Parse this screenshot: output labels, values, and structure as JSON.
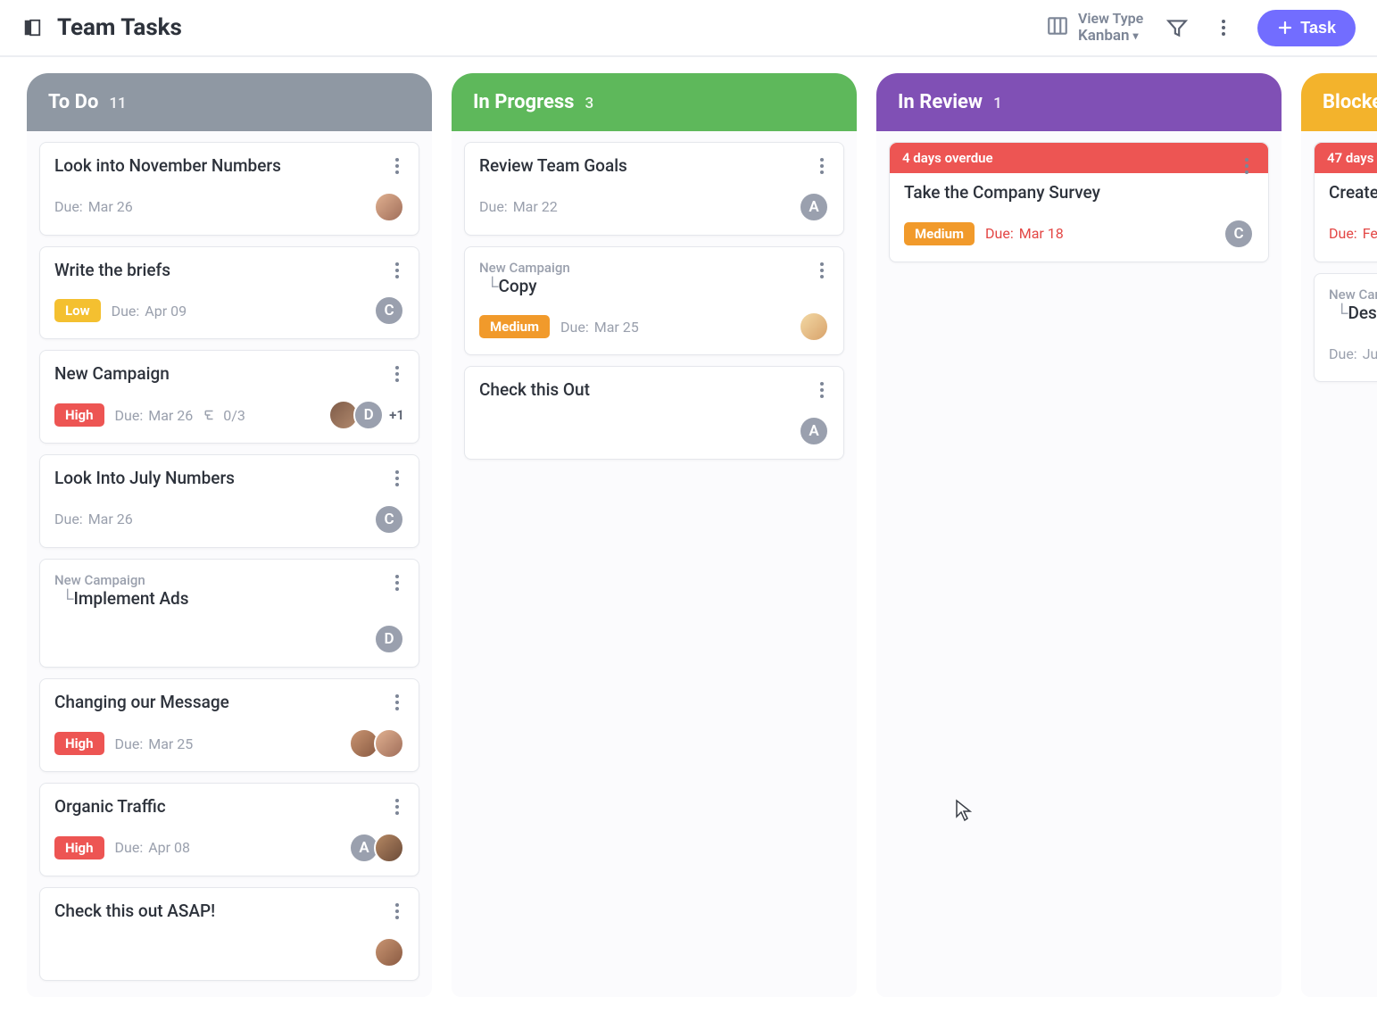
{
  "header": {
    "title": "Team Tasks",
    "view_type_label": "View Type",
    "view_type_value": "Kanban",
    "add_task_label": "Task"
  },
  "columns": [
    {
      "id": "todo",
      "title": "To Do",
      "count": "11",
      "cards": [
        {
          "title": "Look into November Numbers",
          "due": "Mar 26",
          "assignees": [
            {
              "t": "p",
              "v": "p1"
            }
          ]
        },
        {
          "title": "Write the briefs",
          "priority": "Low",
          "due": "Apr 09",
          "assignees": [
            {
              "t": "l",
              "v": "C"
            }
          ]
        },
        {
          "title": "New Campaign",
          "priority": "High",
          "due": "Mar 26",
          "subtasks": "0/3",
          "assignees": [
            {
              "t": "p",
              "v": "p3"
            },
            {
              "t": "l",
              "v": "D"
            }
          ],
          "more_count": "+1"
        },
        {
          "title": "Look Into July Numbers",
          "due": "Mar 26",
          "assignees": [
            {
              "t": "l",
              "v": "C"
            }
          ]
        },
        {
          "parent": "New Campaign",
          "title": "Implement Ads",
          "assignees": [
            {
              "t": "l",
              "v": "D"
            }
          ]
        },
        {
          "title": "Changing our Message",
          "priority": "High",
          "due": "Mar 25",
          "assignees": [
            {
              "t": "p",
              "v": "p4"
            },
            {
              "t": "p",
              "v": "p1"
            }
          ]
        },
        {
          "title": "Organic Traffic",
          "priority": "High",
          "due": "Apr 08",
          "assignees": [
            {
              "t": "l",
              "v": "A"
            },
            {
              "t": "p",
              "v": "p5"
            }
          ]
        },
        {
          "title": "Check this out ASAP!",
          "assignees": [
            {
              "t": "p",
              "v": "p4"
            }
          ]
        }
      ]
    },
    {
      "id": "progress",
      "title": "In Progress",
      "count": "3",
      "cards": [
        {
          "title": "Review Team Goals",
          "due": "Mar 22",
          "assignees": [
            {
              "t": "l",
              "v": "A"
            }
          ]
        },
        {
          "parent": "New Campaign",
          "title": "Copy",
          "priority": "Medium",
          "due": "Mar 25",
          "assignees": [
            {
              "t": "p",
              "v": "p2"
            }
          ]
        },
        {
          "title": "Check this Out",
          "assignees": [
            {
              "t": "l",
              "v": "A"
            }
          ]
        }
      ]
    },
    {
      "id": "review",
      "title": "In Review",
      "count": "1",
      "cards": [
        {
          "overdue": "4 days overdue",
          "title": "Take the Company Survey",
          "priority": "Medium",
          "due": "Mar 18",
          "due_overdue": true,
          "assignees": [
            {
              "t": "l",
              "v": "C"
            }
          ]
        }
      ]
    },
    {
      "id": "blocked",
      "title": "Blocked",
      "count": "",
      "cards": [
        {
          "overdue": "47 days",
          "title": "Create",
          "due": "Fe",
          "due_overdue": true
        },
        {
          "parent": "New Campaign",
          "title": "Design",
          "due": "Ju"
        }
      ]
    }
  ],
  "labels": {
    "due": "Due:"
  }
}
